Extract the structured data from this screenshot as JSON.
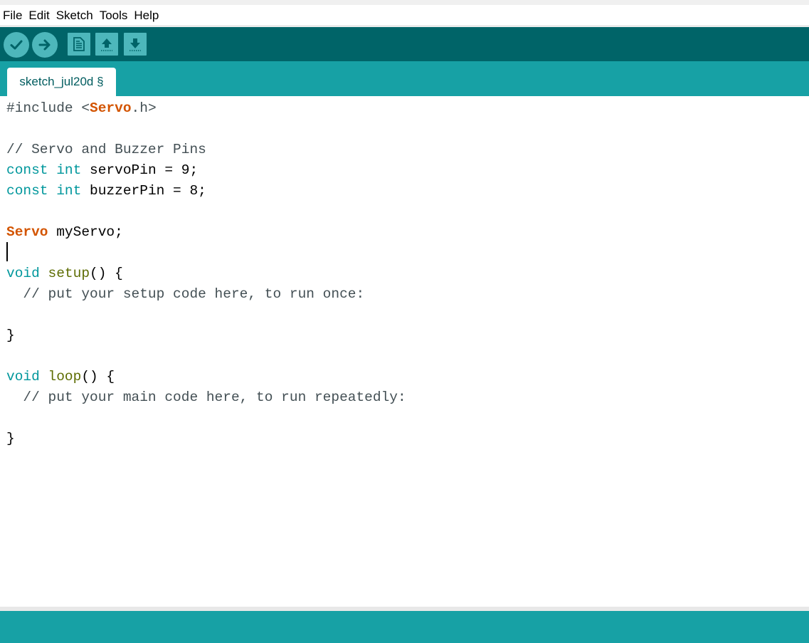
{
  "menu": {
    "items": [
      "File",
      "Edit",
      "Sketch",
      "Tools",
      "Help"
    ]
  },
  "toolbar": {
    "buttons": [
      {
        "name": "verify",
        "icon": "check-icon"
      },
      {
        "name": "upload",
        "icon": "arrow-right-icon"
      },
      {
        "name": "new",
        "icon": "document-icon"
      },
      {
        "name": "open",
        "icon": "arrow-up-icon"
      },
      {
        "name": "save",
        "icon": "arrow-down-icon"
      }
    ]
  },
  "tab": {
    "label": "sketch_jul20d §"
  },
  "code": {
    "line1": {
      "a": "#include <",
      "b": "Servo",
      "c": ".h>"
    },
    "line3": {
      "a": "// Servo and Buzzer Pins"
    },
    "line4": {
      "a": "const",
      "b": " ",
      "c": "int",
      "d": " servoPin = 9;"
    },
    "line5": {
      "a": "const",
      "b": " ",
      "c": "int",
      "d": " buzzerPin = 8;"
    },
    "line7": {
      "a": "Servo",
      "b": " myServo;"
    },
    "line9": {
      "a": "void",
      "b": " ",
      "c": "setup",
      "d": "() {"
    },
    "line10": {
      "a": "  // put your setup code here, to run once:"
    },
    "line12": {
      "a": "}"
    },
    "line14": {
      "a": "void",
      "b": " ",
      "c": "loop",
      "d": "() {"
    },
    "line15": {
      "a": "  // put your main code here, to run repeatedly:"
    },
    "line17": {
      "a": "}"
    }
  },
  "colors": {
    "toolbar": "#006468",
    "tabbar": "#17a1a5",
    "button": "#4db7bb",
    "keyword": "#00979c",
    "class": "#d35400",
    "function": "#5e6d03"
  }
}
